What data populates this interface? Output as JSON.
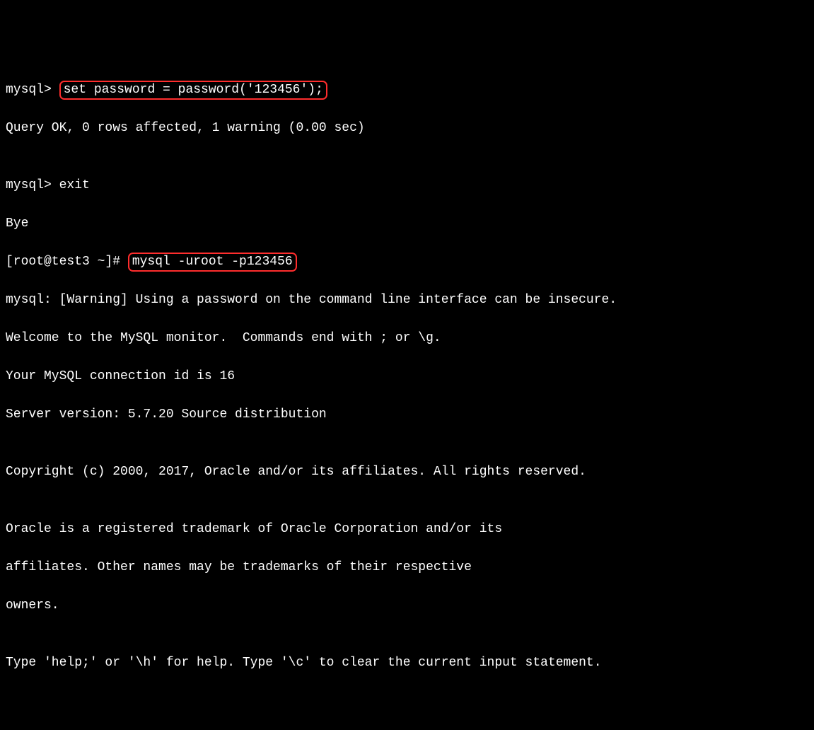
{
  "line1": {
    "prompt": "mysql> ",
    "cmd": "set password = password('123456');"
  },
  "line2": "Query OK, 0 rows affected, 1 warning (0.00 sec)",
  "line3": "",
  "line4": {
    "prompt": "mysql> ",
    "cmd": "exit"
  },
  "line5": "Bye",
  "line6": {
    "prompt": "[root@test3 ~]# ",
    "cmd": "mysql -uroot -p123456"
  },
  "line7": "mysql: [Warning] Using a password on the command line interface can be insecure.",
  "line8": "Welcome to the MySQL monitor.  Commands end with ; or \\g.",
  "line9": "Your MySQL connection id is 16",
  "line10": "Server version: 5.7.20 Source distribution",
  "line11": "",
  "line12": "Copyright (c) 2000, 2017, Oracle and/or its affiliates. All rights reserved.",
  "line13": "",
  "line14": "Oracle is a registered trademark of Oracle Corporation and/or its",
  "line15": "affiliates. Other names may be trademarks of their respective",
  "line16": "owners.",
  "line17": "",
  "line18": "Type 'help;' or '\\h' for help. Type '\\c' to clear the current input statement."
}
